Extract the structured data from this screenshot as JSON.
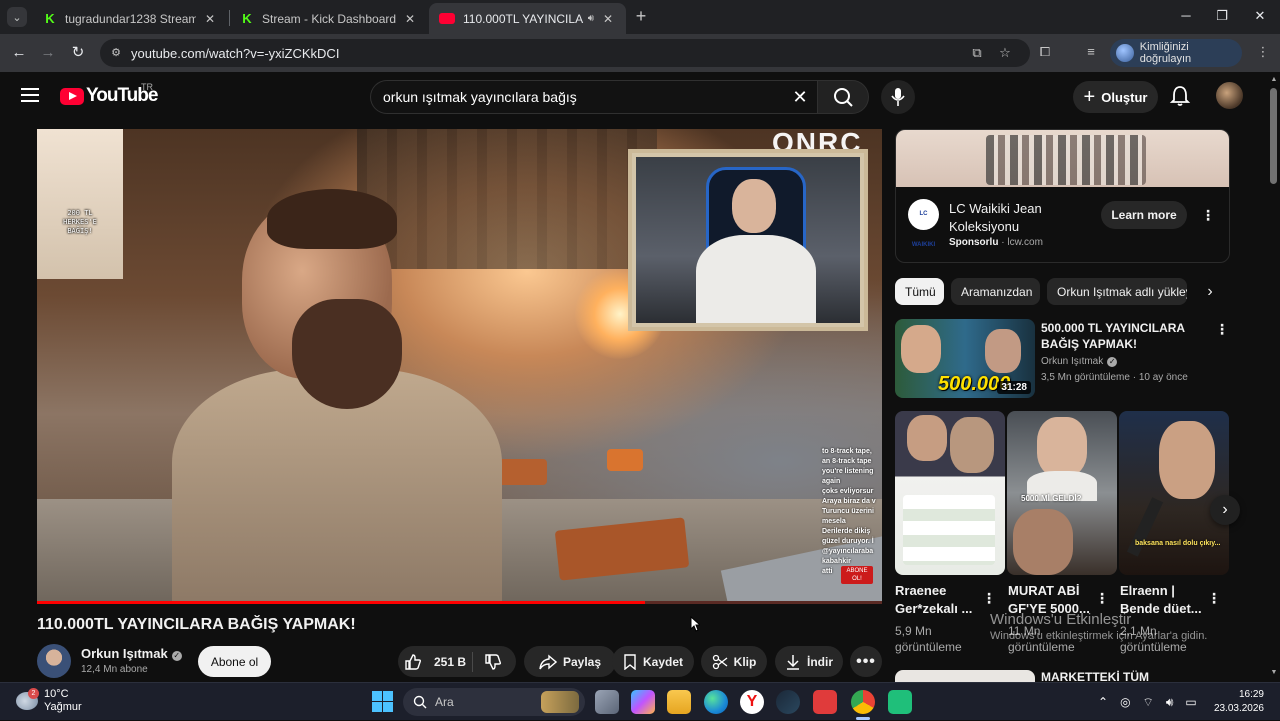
{
  "browser": {
    "tabs": [
      {
        "title": "tugradundar1238 Stream - Wat",
        "icon": "kick-icon",
        "active": false
      },
      {
        "title": "Stream - Kick Dashboard",
        "icon": "kick-icon",
        "active": false
      },
      {
        "title": "110.000TL YAYINCILARA BA",
        "icon": "youtube-icon",
        "active": true,
        "audio": true
      }
    ],
    "url": "youtube.com/watch?v=-yxiZCKkDCI",
    "profile_label": "Kimliğinizi doğrulayın"
  },
  "masthead": {
    "logo_text": "YouTube",
    "region": "TR",
    "search_query": "orkun ışıtmak yayıncılara bağış",
    "create_label": "Oluştur"
  },
  "player": {
    "corner_logo": "ONRC",
    "qr_caption": "200 TL\nHERKES'E\nBAĞIŞ!",
    "chat_lines": [
      "to 8-track tape,",
      "an 8-track tape",
      "you're listening",
      "again",
      "çoks evliyorsur",
      "Araya biraz da v",
      "Turuncu üzerini",
      "mesela",
      "Derilerde dikiş",
      "güzel duruyor. İ",
      "@yayıncılaraba",
      "kabahkir",
      "atti"
    ],
    "abone_label": "ABONE OL!",
    "progress": 0.72
  },
  "video": {
    "title": "110.000TL YAYINCILARA BAĞIŞ YAPMAK!",
    "channel_name": "Orkun Işıtmak",
    "subscribers": "12,4 Mn abone",
    "subscribe_label": "Abone ol",
    "likes": "251 B",
    "share_label": "Paylaş",
    "save_label": "Kaydet",
    "clip_label": "Klip",
    "download_label": "İndir"
  },
  "ad": {
    "logo_text": "LC WAIKIKI",
    "title": "LC Waikiki Jean Koleksiyonu",
    "sponsor_label": "Sponsorlu",
    "domain": "lcw.com",
    "cta": "Learn more"
  },
  "chips": [
    "Tümü",
    "Aramanızdan",
    "Orkun Işıtmak adlı yükleyen"
  ],
  "recommended": {
    "title": "500.000 TL YAYINCILARA BAĞIŞ YAPMAK!",
    "thumb_text": "500.000",
    "duration": "31:28",
    "channel": "Orkun Işıtmak",
    "views": "3,5 Mn görüntüleme",
    "age": "10 ay önce"
  },
  "shorts": [
    {
      "title": "Rraenee Ger*zekalı ...",
      "views": "5,9 Mn görüntüleme"
    },
    {
      "title": "MURAT ABİ GF'YE 5000...",
      "views": "11 Mn görüntüleme",
      "thumb_text": "5000 Mİ GELDİ?"
    },
    {
      "title": "Elraenn | Bende düet...",
      "views": "2,1 Mn görüntüleme",
      "thumb_text": "baksana nasıl dolu çıkıy..."
    }
  ],
  "next_rec_title": "MARKETTEKİ TÜM",
  "windows_watermark": {
    "title": "Windows'u Etkinleştir",
    "subtitle": "Windows'u etkinleştirmek için Ayarlar'a gidin."
  },
  "taskbar": {
    "weather_temp": "10°C",
    "weather_desc": "Yağmur",
    "weather_badge": "2",
    "search_placeholder": "Ara",
    "time": "16:29",
    "date": "23.03.2026"
  },
  "colors": {
    "yt_red": "#ff0033",
    "kick_green": "#53fc18",
    "background": "#0f0f0f"
  }
}
